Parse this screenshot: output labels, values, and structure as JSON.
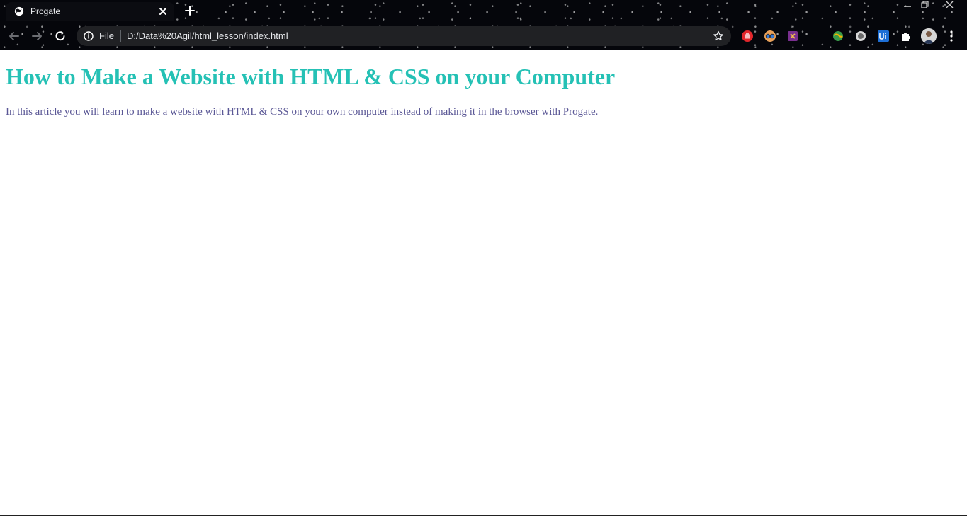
{
  "tab": {
    "title": "Progate"
  },
  "omnibox": {
    "scheme_label": "File",
    "url": "D:/Data%20Agil/html_lesson/index.html"
  },
  "toolbar": {
    "extensions": [
      "red-hand-extension-icon",
      "glasses-extension-icon",
      "purple-x-extension-icon",
      "globe-extension-icon",
      "circle-extension-icon",
      "ui-extension-icon",
      "puzzle-icon"
    ]
  },
  "page": {
    "heading": "How to Make a Website with HTML & CSS on your Computer",
    "paragraph": "In this article you will learn to make a website with HTML & CSS on your own computer instead of making it in the browser with Progate."
  },
  "colors": {
    "heading": "#25c1b5",
    "paragraph": "#5b5896",
    "chrome": "#05060b",
    "omnibox": "#202124"
  }
}
